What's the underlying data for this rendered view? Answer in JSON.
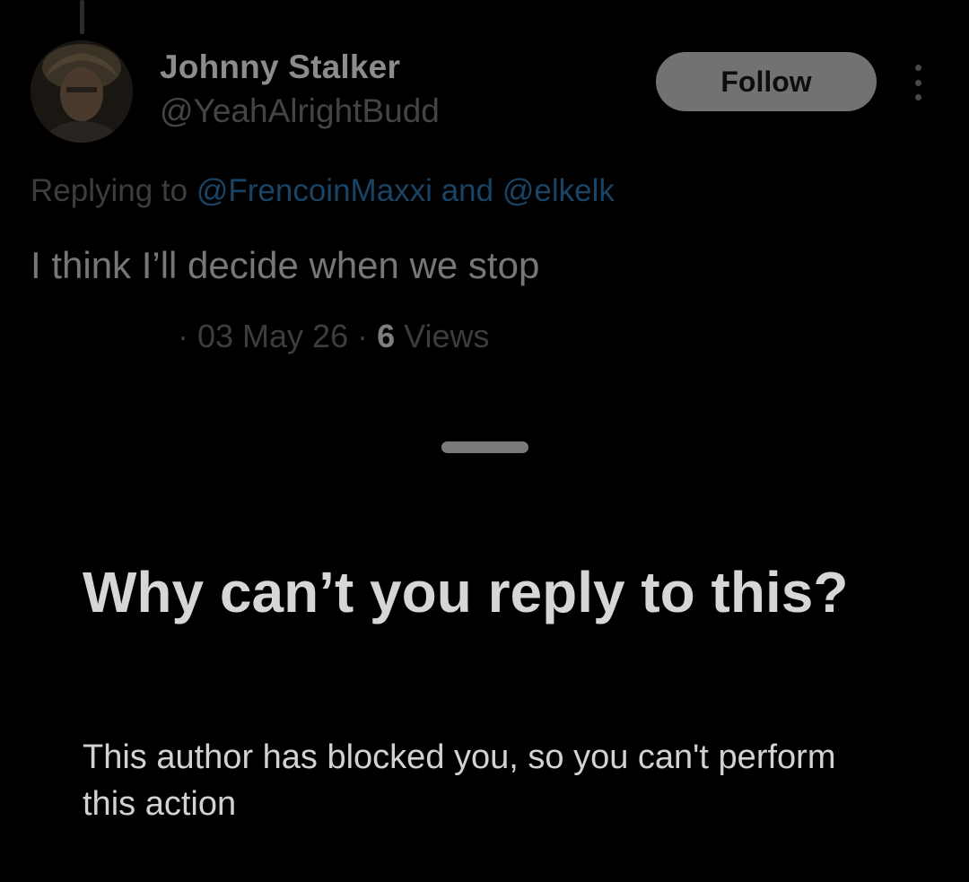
{
  "tweet": {
    "author": {
      "display_name": "Johnny Stalker",
      "handle": "@YeahAlrightBudd",
      "avatar_icon": "user-avatar-photo"
    },
    "follow_label": "Follow",
    "more_icon": "more-vertical-icon",
    "replying_prefix": "Replying to",
    "replying_user_1": "@FrencoinMaxxi",
    "replying_and": "and",
    "replying_user_2": "@elkelk",
    "text": "I think I’ll decide when we stop",
    "meta": {
      "date": "· 03 May 26 ·",
      "views_count": "6",
      "views_label": "Views"
    }
  },
  "sheet": {
    "title": "Why can’t you reply to this?",
    "body": "This author has blocked you, so you can't perform this action"
  },
  "colors": {
    "background": "#000000",
    "link_dimmed": "#1a4466",
    "follow_button": "#727272"
  }
}
